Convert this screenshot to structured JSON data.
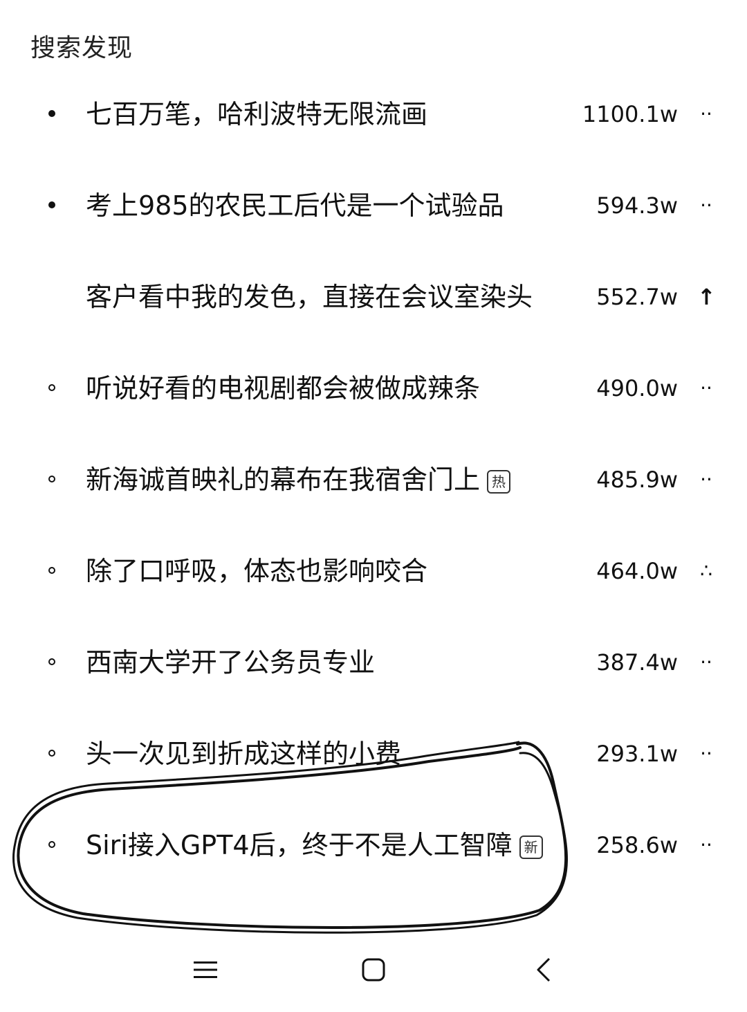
{
  "section_title": "搜索发现",
  "items": [
    {
      "title": "七百万笔，哈利波特无限流画",
      "count": "1100.1w",
      "trend": "··",
      "bullet": "filled",
      "tag": ""
    },
    {
      "title": "考上985的农民工后代是一个试验品",
      "count": "594.3w",
      "trend": "··",
      "bullet": "filled",
      "tag": ""
    },
    {
      "title": "客户看中我的发色，直接在会议室染头",
      "count": "552.7w",
      "trend": "↑",
      "bullet": "none",
      "tag": ""
    },
    {
      "title": "听说好看的电视剧都会被做成辣条",
      "count": "490.0w",
      "trend": "··",
      "bullet": "open",
      "tag": ""
    },
    {
      "title": "新海诚首映礼的幕布在我宿舍门上",
      "count": "485.9w",
      "trend": "··",
      "bullet": "open",
      "tag": "热"
    },
    {
      "title": "除了口呼吸，体态也影响咬合",
      "count": "464.0w",
      "trend": "∴",
      "bullet": "open",
      "tag": ""
    },
    {
      "title": "西南大学开了公务员专业",
      "count": "387.4w",
      "trend": "··",
      "bullet": "open",
      "tag": ""
    },
    {
      "title": "头一次见到折成这样的小费",
      "count": "293.1w",
      "trend": "··",
      "bullet": "open",
      "tag": ""
    },
    {
      "title": "Siri接入GPT4后，终于不是人工智障",
      "count": "258.6w",
      "trend": "··",
      "bullet": "open",
      "tag": "新"
    }
  ],
  "nav": {
    "menu_icon": "menu-icon",
    "home_icon": "home-icon",
    "back_icon": "back-icon"
  },
  "colors": {
    "text": "#111111",
    "background": "#ffffff",
    "annotation": "#111111"
  }
}
